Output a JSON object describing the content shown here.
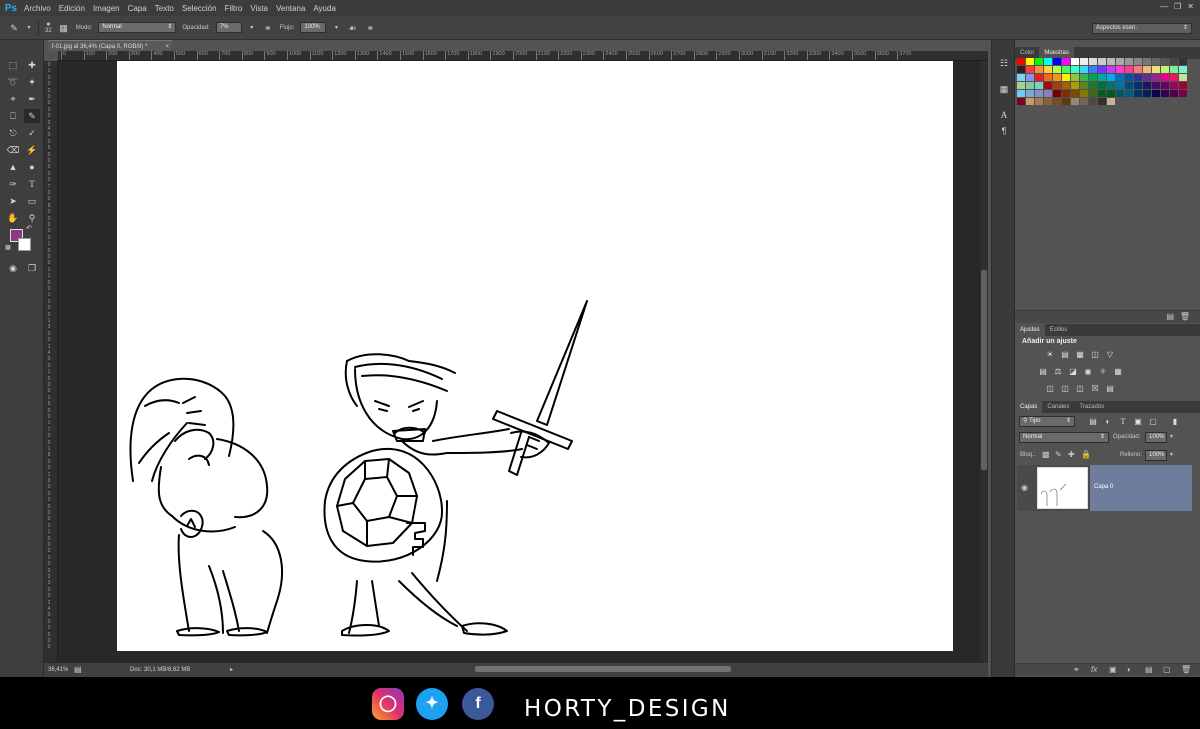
{
  "app": {
    "logo": "Ps"
  },
  "menu": [
    "Archivo",
    "Edición",
    "Imagen",
    "Capa",
    "Texto",
    "Selección",
    "Filtro",
    "Vista",
    "Ventana",
    "Ayuda"
  ],
  "options": {
    "brush_size": "32",
    "mode_label": "Modo:",
    "mode_value": "Normal",
    "opacity_label": "Opacidad:",
    "opacity_value": "7%",
    "flow_label": "Flujo:",
    "flow_value": "100%",
    "workspace": "Aspectos esen."
  },
  "document": {
    "tab_title": "f-01.jpg al 36,4% (Capa 0, RGB/8) *",
    "ruler_h": [
      "0",
      "100",
      "200",
      "300",
      "400",
      "500",
      "600",
      "700",
      "800",
      "900",
      "1000",
      "1100",
      "1200",
      "1300",
      "1400",
      "1500",
      "1600",
      "1700",
      "1800",
      "1900",
      "2000",
      "2100",
      "2200",
      "2300",
      "2400",
      "2500",
      "2600",
      "2700",
      "2800",
      "2900",
      "3000",
      "3100",
      "3200",
      "3300",
      "3400",
      "3500",
      "3600",
      "3700"
    ],
    "ruler_v": [
      "0",
      "1",
      "0",
      "0",
      "2",
      "0",
      "0",
      "3",
      "0",
      "0",
      "4",
      "0",
      "0",
      "5",
      "0",
      "0",
      "6",
      "0",
      "0",
      "7",
      "0",
      "0",
      "8",
      "0",
      "0",
      "9",
      "0",
      "0",
      "1",
      "0",
      "0",
      "0",
      "1",
      "1",
      "0",
      "0",
      "1",
      "2",
      "0",
      "0",
      "1",
      "3",
      "0",
      "0",
      "1",
      "4",
      "0",
      "0",
      "1",
      "5",
      "0",
      "0",
      "1",
      "6",
      "0",
      "0",
      "1",
      "7",
      "0",
      "0",
      "1",
      "8",
      "0",
      "0",
      "1",
      "9",
      "0",
      "0",
      "2",
      "0",
      "0",
      "0",
      "2",
      "1",
      "0",
      "0",
      "2",
      "2",
      "0",
      "0",
      "2",
      "3",
      "0",
      "0",
      "2",
      "4",
      "0",
      "0",
      "2",
      "5",
      "0",
      "0"
    ]
  },
  "status": {
    "zoom": "36,41%",
    "doc_info": "Doc: 30,1 MB/8,62 MB"
  },
  "panels": {
    "color_tabs": [
      "Color",
      "Muestras"
    ],
    "adjust_tabs": [
      "Ajustes",
      "Estilos"
    ],
    "adjust_title": "Añadir un ajuste",
    "layer_tabs": [
      "Capas",
      "Canales",
      "Trazados"
    ],
    "filter_kind": "Tipo",
    "blend_mode": "Normal",
    "opacity_label": "Opacidad:",
    "opacity_value": "100%",
    "lock_label": "Bloq.:",
    "fill_label": "Relleno:",
    "fill_value": "100%",
    "layer_name": "Capa 0"
  },
  "colors": {
    "foreground": "#8a3c7e",
    "background": "#ffffff"
  },
  "swatches": [
    "#ff0000",
    "#ffff00",
    "#00ff00",
    "#00ffff",
    "#0000ff",
    "#ff00ff",
    "#ffffff",
    "#eeeeee",
    "#dddddd",
    "#cccccc",
    "#bbbbbb",
    "#aaaaaa",
    "#999999",
    "#888888",
    "#777777",
    "#666666",
    "#555555",
    "#444444",
    "#333333",
    "#222222",
    "#ff3b3b",
    "#ff8f3b",
    "#ffd43b",
    "#b4ff3b",
    "#3bff5b",
    "#3bffc8",
    "#3bd4ff",
    "#3b7aff",
    "#6b3bff",
    "#c83bff",
    "#ff3bd4",
    "#ff3b8f",
    "#f07c7c",
    "#f0b67c",
    "#f0e07c",
    "#c4f07c",
    "#7cf094",
    "#7cf0d8",
    "#7cd0f0",
    "#7c98f0",
    "#ed1c24",
    "#f26522",
    "#f7941d",
    "#fff200",
    "#8dc63f",
    "#39b54a",
    "#00a651",
    "#00a99d",
    "#00aeef",
    "#0072bc",
    "#0054a6",
    "#2e3192",
    "#662d91",
    "#92278f",
    "#ec008c",
    "#ed145b",
    "#c4df9b",
    "#a2d39c",
    "#82ca9d",
    "#7bcdc8",
    "#9e0b0f",
    "#a0410d",
    "#a36209",
    "#aba000",
    "#598527",
    "#1a7b30",
    "#007236",
    "#00746b",
    "#0076a3",
    "#004b80",
    "#003471",
    "#1b1464",
    "#440e62",
    "#630460",
    "#9e005d",
    "#9e0039",
    "#6dcff6",
    "#7da7d9",
    "#8393ca",
    "#8781bd",
    "#790000",
    "#7b2e00",
    "#7d4900",
    "#827b00",
    "#406618",
    "#005e20",
    "#005826",
    "#005952",
    "#005b7f",
    "#003663",
    "#002157",
    "#0d004c",
    "#32004b",
    "#4b0049",
    "#7b0046",
    "#7a0026",
    "#c69c6d",
    "#a67c52",
    "#8c6239",
    "#754c24",
    "#603913",
    "#998675",
    "#736357",
    "#534741",
    "#362f2d",
    "#c7b299"
  ]
}
